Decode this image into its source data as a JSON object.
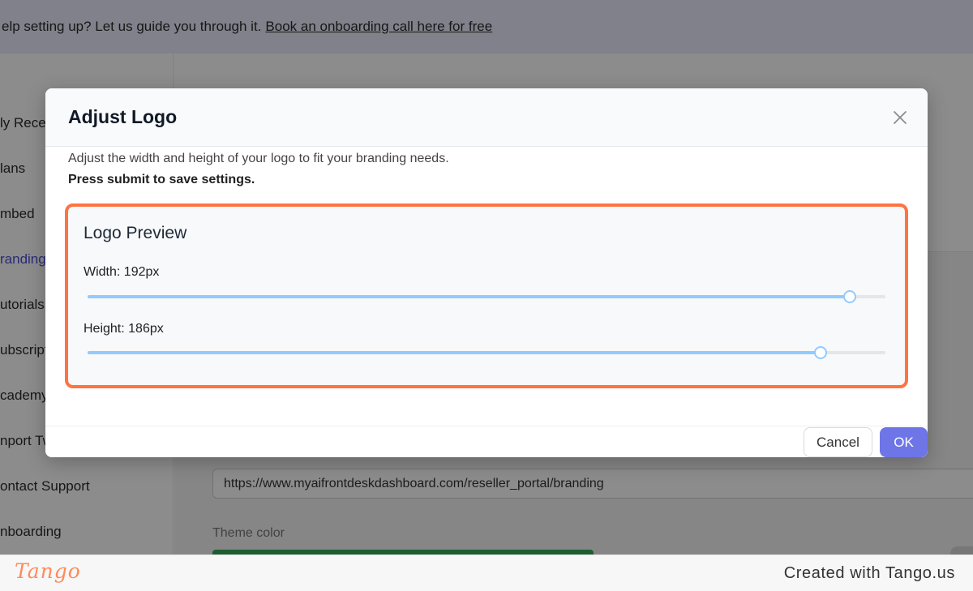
{
  "banner": {
    "text": "elp setting up? Let us guide you through it.",
    "link": "Book an onboarding call here for free"
  },
  "sidebar": {
    "items": [
      {
        "label": "ly Recep"
      },
      {
        "label": "lans"
      },
      {
        "label": "mbed"
      },
      {
        "label": "randing"
      },
      {
        "label": "utorials"
      },
      {
        "label": "ubscript"
      },
      {
        "label": "cademy"
      },
      {
        "label": "nport Tw"
      },
      {
        "label": "ontact Support"
      },
      {
        "label": "nboarding"
      }
    ]
  },
  "content": {
    "url_value": "https://www.myaifrontdeskdashboard.com/reseller_portal/branding",
    "theme_label": "Theme color"
  },
  "modal": {
    "title": "Adjust Logo",
    "close_icon": "close-icon",
    "description": "Adjust the width and height of your logo to fit your branding needs.",
    "note": "Press submit to save settings.",
    "preview_title": "Logo Preview",
    "width_label": "Width: 192px",
    "width_fraction": 0.955,
    "height_label": "Height: 186px",
    "height_fraction": 0.919,
    "cancel_label": "Cancel",
    "ok_label": "OK"
  },
  "colors": {
    "highlight": "#ff7340",
    "primary": "#6e75e6",
    "slider": "#91caff",
    "theme_swatch": "#3aa85a"
  },
  "footer": {
    "logo": "Tango",
    "credit": "Created with Tango.us"
  }
}
